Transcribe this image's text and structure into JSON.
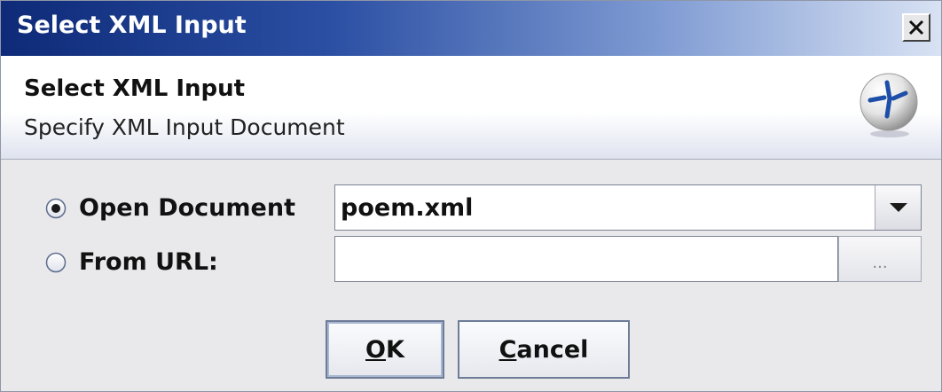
{
  "window": {
    "title": "Select XML Input",
    "close_label": "X"
  },
  "header": {
    "title": "Select XML Input",
    "subtitle": "Specify XML Input Document"
  },
  "options": {
    "open_document": {
      "label": "Open Document",
      "selected": true
    },
    "from_url": {
      "label": "From URL:",
      "selected": false
    }
  },
  "document_select": {
    "value": "poem.xml"
  },
  "url_field": {
    "value": "",
    "placeholder": ""
  },
  "browse_button": {
    "label": "..."
  },
  "buttons": {
    "ok": {
      "mnemonic": "O",
      "rest": "K"
    },
    "cancel": {
      "mnemonic": "C",
      "rest": "ancel"
    }
  },
  "colors": {
    "titlebar_start": "#0e2a78",
    "titlebar_end": "#d8e2f3",
    "dialog_background": "#e9e9ec"
  }
}
